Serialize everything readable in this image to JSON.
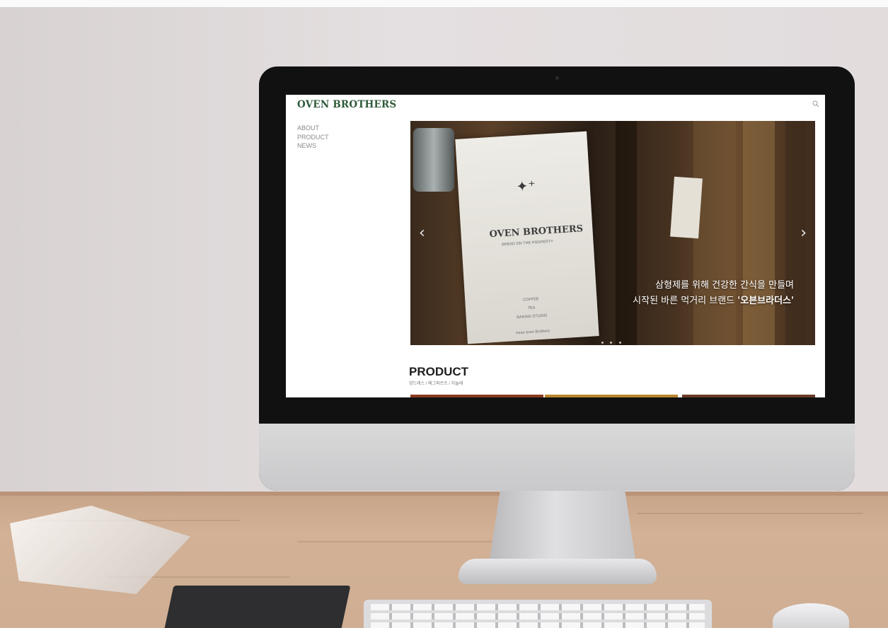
{
  "site": {
    "logo": "OVEN BROTHERS",
    "nav": [
      "ABOUT",
      "PRODUCT",
      "NEWS"
    ],
    "hero": {
      "board_title": "OVEN BROTHERS",
      "board_tagline": "BREAD ON THE PROPERTY",
      "board_items": [
        "COFFEE",
        "TEA",
        "BAKING STUDIO"
      ],
      "board_footer": "Irese aven Brothers",
      "caption_line1": "삼형제를 위해 건강한 간식을 만들며",
      "caption_line2_prefix": "시작된 바른 먹거리 브랜드 ",
      "caption_line2_brand": "'오븐브라더스'",
      "prev_arrow": "‹",
      "next_arrow": "›",
      "slide_count": 3
    },
    "product": {
      "title": "PRODUCT",
      "subtitle": "양드레스 / 메그파르츠 / 치놀래"
    }
  },
  "icons": [
    "search-icon",
    "chevron-left-icon",
    "chevron-right-icon",
    "sparkle-icon"
  ],
  "colors": {
    "logo_green": "#2f5a3a",
    "nav_gray": "#8a8a8a",
    "caption_white": "#ffffff",
    "wall": "#e2dcdd",
    "desk_wood": "#cfae93"
  }
}
